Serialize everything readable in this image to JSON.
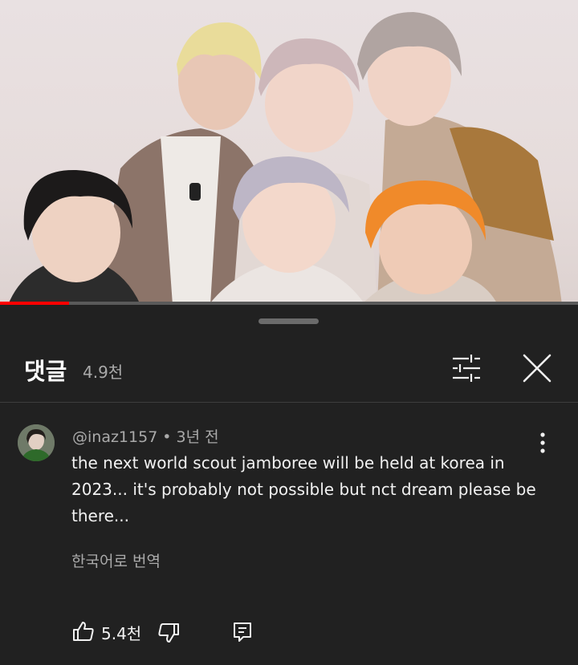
{
  "video": {
    "description_icon": "video-frame",
    "progress_fraction": 0.12,
    "progress_color": "#ff0000"
  },
  "panel": {
    "title": "댓글",
    "count": "4.9천",
    "filter_icon": "sliders-icon",
    "close_icon": "close-icon"
  },
  "comment": {
    "author": "@inaz1157",
    "separator": "•",
    "time": "3년 전",
    "text": "the next world scout jamboree will be held at korea in 2023... it's probably not possible but nct dream please be there...",
    "translate_label": "한국어로 번역",
    "like_count": "5.4천"
  },
  "colors": {
    "background": "#212121",
    "secondary_text": "#aaaaaa",
    "primary_text": "#f1f1f1"
  }
}
